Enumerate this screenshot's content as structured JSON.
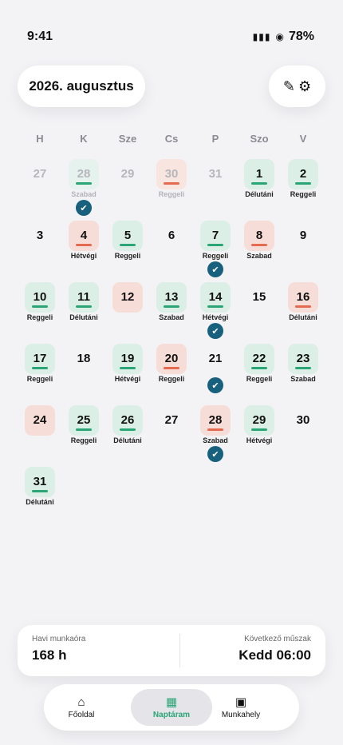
{
  "status": {
    "time": "9:41",
    "signal": "▮▮▮",
    "wifi": "◉",
    "battery": "78%"
  },
  "header": {
    "month": "2026. augusztus",
    "edit_icon": "✎",
    "settings_icon": "⚙"
  },
  "weekdays": [
    "H",
    "K",
    "Sze",
    "Cs",
    "P",
    "Szo",
    "V"
  ],
  "colors": {
    "green": "#2aa676",
    "red": "#e66a4f",
    "check": "#17607e"
  },
  "days": [
    {
      "n": "27",
      "muted": true
    },
    {
      "n": "28",
      "muted": true,
      "tint": "green",
      "bar": "green",
      "label": "Szabad",
      "check": true
    },
    {
      "n": "29",
      "muted": true
    },
    {
      "n": "30",
      "muted": true,
      "tint": "red",
      "bar": "red",
      "label": "Reggeli"
    },
    {
      "n": "31",
      "muted": true
    },
    {
      "n": "1",
      "tint": "green",
      "bar": "green",
      "label": "Délutáni"
    },
    {
      "n": "2",
      "tint": "green",
      "bar": "green",
      "label": "Reggeli"
    },
    {
      "n": "3"
    },
    {
      "n": "4",
      "tint": "red",
      "bar": "red",
      "label": "Hétvégi"
    },
    {
      "n": "5",
      "tint": "green",
      "bar": "green",
      "label": "Reggeli"
    },
    {
      "n": "6"
    },
    {
      "n": "7",
      "tint": "green",
      "bar": "green",
      "label": "Reggeli",
      "check": true
    },
    {
      "n": "8",
      "tint": "red",
      "bar": "red",
      "label": "Szabad"
    },
    {
      "n": "9"
    },
    {
      "n": "10",
      "tint": "green",
      "bar": "green",
      "label": "Reggeli"
    },
    {
      "n": "11",
      "tint": "green",
      "bar": "green",
      "label": "Délutáni"
    },
    {
      "n": "12",
      "tint": "red"
    },
    {
      "n": "13",
      "tint": "green",
      "bar": "green",
      "label": "Szabad"
    },
    {
      "n": "14",
      "tint": "green",
      "bar": "green",
      "label": "Hétvégi",
      "check": true
    },
    {
      "n": "15"
    },
    {
      "n": "16",
      "tint": "red",
      "bar": "red",
      "label": "Délutáni"
    },
    {
      "n": "17",
      "tint": "green",
      "bar": "green",
      "label": "Reggeli"
    },
    {
      "n": "18"
    },
    {
      "n": "19",
      "tint": "green",
      "bar": "green",
      "label": "Hétvégi"
    },
    {
      "n": "20",
      "tint": "red",
      "bar": "red",
      "label": "Reggeli"
    },
    {
      "n": "21",
      "check": true
    },
    {
      "n": "22",
      "tint": "green",
      "bar": "green",
      "label": "Reggeli"
    },
    {
      "n": "23",
      "tint": "green",
      "bar": "green",
      "label": "Szabad"
    },
    {
      "n": "24",
      "tint": "red"
    },
    {
      "n": "25",
      "tint": "green",
      "bar": "green",
      "label": "Reggeli"
    },
    {
      "n": "26",
      "tint": "green",
      "bar": "green",
      "label": "Délutáni"
    },
    {
      "n": "27"
    },
    {
      "n": "28",
      "tint": "red",
      "bar": "red",
      "label": "Szabad",
      "check": true
    },
    {
      "n": "29",
      "tint": "green",
      "bar": "green",
      "label": "Hétvégi"
    },
    {
      "n": "30"
    },
    {
      "n": "31",
      "tint": "green",
      "bar": "green",
      "label": "Délutáni"
    }
  ],
  "check_icon": "✔",
  "summary": {
    "hours_label": "Havi munkaóra",
    "hours_value": "168 h",
    "next_label": "Következő műszak",
    "next_value": "Kedd 06:00"
  },
  "nav": [
    {
      "icon": "⌂",
      "icon_name": "home-icon",
      "label": "Főoldal",
      "active": false
    },
    {
      "icon": "▦",
      "icon_name": "calendar-icon",
      "label": "Naptáram",
      "active": true
    },
    {
      "icon": "▣",
      "icon_name": "workplace-icon",
      "label": "Munkahely",
      "active": false
    }
  ]
}
